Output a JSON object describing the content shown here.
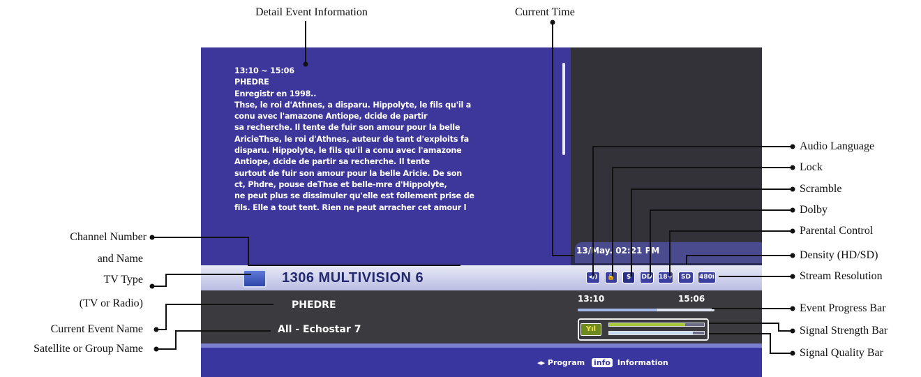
{
  "callouts": {
    "detail_event_information": "Detail Event Information",
    "current_time": "Current Time",
    "channel_number_and_name": [
      "Channel Number",
      "and Name"
    ],
    "tv_type": [
      "TV Type",
      "(TV or Radio)"
    ],
    "current_event_name": "Current Event Name",
    "satellite_or_group_name": "Satellite or Group Name",
    "audio_language": "Audio Language",
    "lock": "Lock",
    "scramble": "Scramble",
    "dolby": "Dolby",
    "parental_control": "Parental Control",
    "density": "Density (HD/SD)",
    "stream_resolution": "Stream Resolution",
    "event_progress_bar": "Event Progress Bar",
    "signal_strength_bar": "Signal Strength Bar",
    "signal_quality_bar": "Signal Quality Bar"
  },
  "screen": {
    "detail_lines": [
      "13:10 ~ 15:06",
      "PHEDRE",
      "Enregistr en 1998..",
      "Thse, le roi d'Athnes, a disparu. Hippolyte, le fils qu'il a",
      "conu avec l'amazone Antiope, dcide de partir",
      " sa recherche. Il tente de fuir son amour pour la belle",
      "AricieThse, le roi d'Athnes, auteur de tant d'exploits fa",
      "disparu. Hippolyte, le fils qu'il a conu avec l'amazone",
      "Antiope, dcide de partir  sa recherche. Il tente",
      "surtout de fuir son amour pour la belle Aricie. De son",
      "ct, Phdre, pouse deThse et belle-mre d'Hippolyte,",
      "ne peut plus se dissimuler qu'elle est follement prise de",
      "fils. Elle a tout tent. Rien ne peut arracher cet amour l"
    ],
    "current_time": "13/May.  02:21 PM",
    "channel": "1306  MULTIVISION 6",
    "status_icons": {
      "audio": "◂))",
      "lock": "🔒",
      "scramble": "$",
      "dolby": "DD",
      "parental": "18+",
      "density": "SD",
      "resolution": "480i"
    },
    "event_name": "PHEDRE",
    "group_name": "All - Echostar  7",
    "start_time": "13:10",
    "end_time": "15:06",
    "event_progress": 0.58,
    "signal_icon": "Yıl",
    "signal_strength": 0.8,
    "signal_quality": 0.88,
    "footer": {
      "arrows": "◂▸",
      "program": "Program",
      "info_key": "info",
      "information": "Information"
    }
  },
  "colors": {
    "detail_panel": "#3d369b",
    "channel_bar": "#d5d8ef",
    "info_area": "#3b3a3f",
    "signal_strength_fill": "#a7c93a",
    "signal_quality_fill": "#c6d9ef"
  }
}
